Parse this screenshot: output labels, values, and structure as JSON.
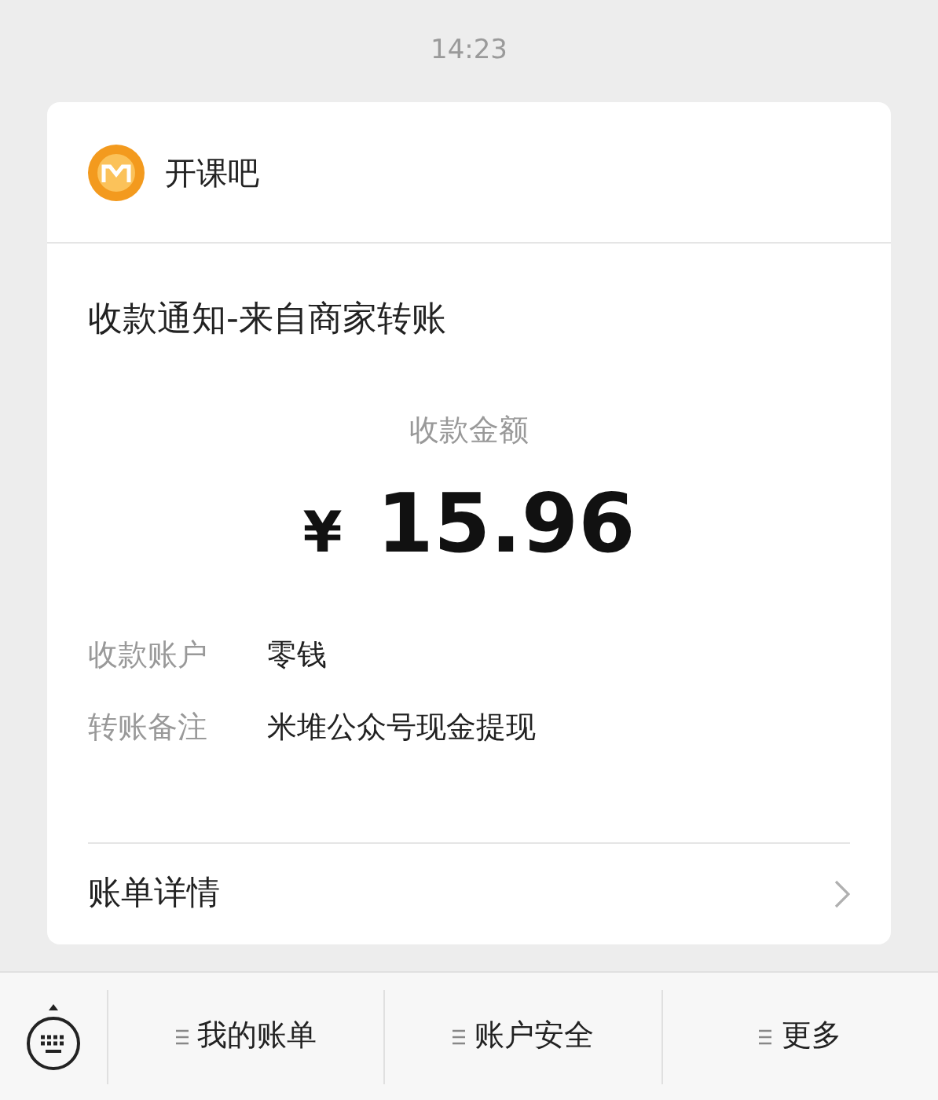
{
  "time": "14:23",
  "card": {
    "sender": "开课吧",
    "title": "收款通知-来自商家转账",
    "amount_label": "收款金额",
    "currency": "¥",
    "amount": "15.96",
    "details": [
      {
        "label": "收款账户",
        "value": "零钱"
      },
      {
        "label": "转账备注",
        "value": "米堆公众号现金提现"
      }
    ],
    "footer_link": "账单详情"
  },
  "menu": [
    {
      "label": "我的账单"
    },
    {
      "label": "账户安全"
    },
    {
      "label": "更多"
    }
  ]
}
